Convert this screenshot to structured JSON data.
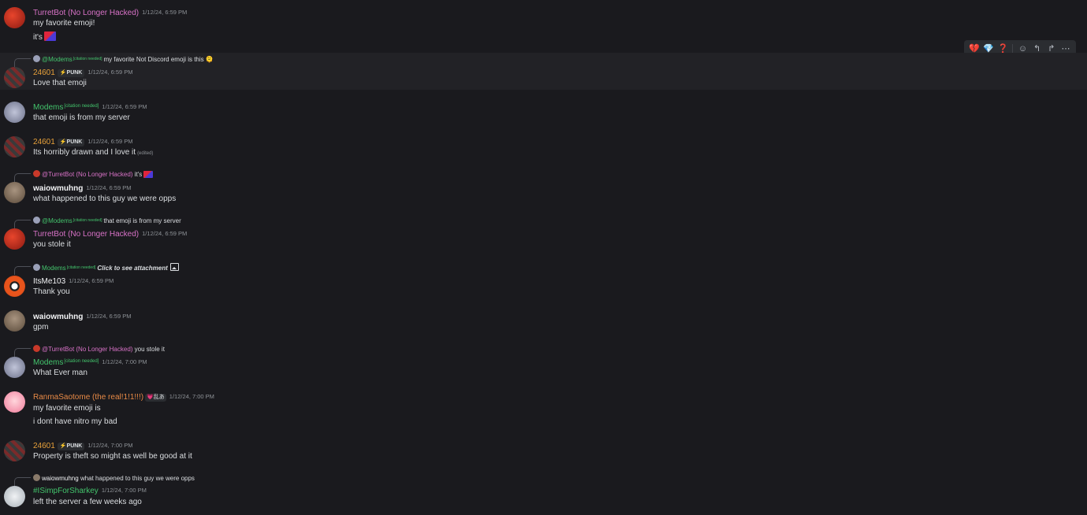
{
  "toolbar": {
    "buttons": [
      {
        "name": "react-broken-heart",
        "glyph": "💔",
        "color": "#e5484d"
      },
      {
        "name": "react-gem",
        "glyph": "💎",
        "color": "#6ec6f0"
      },
      {
        "name": "react-question",
        "glyph": "❓",
        "color": "#e5484d"
      },
      {
        "name": "add-reaction",
        "glyph": "☺",
        "color": "#b5bac1"
      },
      {
        "name": "reply",
        "glyph": "↰",
        "color": "#b5bac1"
      },
      {
        "name": "forward",
        "glyph": "↱",
        "color": "#b5bac1"
      },
      {
        "name": "more",
        "glyph": "⋯",
        "color": "#b5bac1"
      }
    ]
  },
  "messages": [
    {
      "author": "TurretBot (No Longer Hacked)",
      "time": "1/12/24, 6:59 PM",
      "lines": [
        "my favorite emoji!",
        "it's"
      ]
    },
    {
      "reply": {
        "name": "@Modems",
        "tag": "[citation needed]",
        "text": "my favorite Not Discord emoji is this 🫠"
      },
      "author": "24601",
      "badge": "PUNK",
      "time": "1/12/24, 6:59 PM",
      "lines": [
        "Love that emoji"
      ]
    },
    {
      "author": "Modems",
      "tag": "[citation needed]",
      "time": "1/12/24, 6:59 PM",
      "lines": [
        "that emoji is from my server"
      ]
    },
    {
      "author": "24601",
      "badge": "PUNK",
      "time": "1/12/24, 6:59 PM",
      "lines": [
        "Its horribly drawn and I love it"
      ],
      "edited": "(edited)"
    },
    {
      "reply": {
        "name": "@TurretBot (No Longer Hacked)",
        "text": "it's"
      },
      "author": "waiowmuhng",
      "time": "1/12/24, 6:59 PM",
      "lines": [
        "what happened to this guy we were opps"
      ]
    },
    {
      "reply": {
        "name": "@Modems",
        "tag": "[citation needed]",
        "text": "that emoji is from my server"
      },
      "author": "TurretBot (No Longer Hacked)",
      "time": "1/12/24, 6:59 PM",
      "lines": [
        "you stole it"
      ]
    },
    {
      "reply": {
        "name": "Modems",
        "tag": "[citation needed]",
        "text": "Click to see attachment"
      },
      "author": "ItsMe103",
      "time": "1/12/24, 6:59 PM",
      "lines": [
        "Thank you"
      ]
    },
    {
      "author": "waiowmuhng",
      "time": "1/12/24, 6:59 PM",
      "lines": [
        "gpm"
      ]
    },
    {
      "reply": {
        "name": "@TurretBot (No Longer Hacked)",
        "text": "you stole it"
      },
      "author": "Modems",
      "tag": "[citation needed]",
      "time": "1/12/24, 7:00 PM",
      "lines": [
        "What Ever man"
      ]
    },
    {
      "author": "RanmaSaotome (the real!1!1!!!)",
      "pill": "💗乱あ",
      "time": "1/12/24, 7:00 PM",
      "lines": [
        "my favorite emoji is",
        "i dont have nitro my bad"
      ]
    },
    {
      "author": "24601",
      "badge": "PUNK",
      "time": "1/12/24, 7:00 PM",
      "lines": [
        "Property is theft so might as well be good at it"
      ]
    },
    {
      "reply": {
        "name": "waiowmuhng",
        "text": "what happened to this guy we were opps"
      },
      "author": "#ISimpForSharkey",
      "time": "1/12/24, 7:00 PM",
      "lines": [
        "left the server a few weeks ago"
      ]
    }
  ],
  "colors": {
    "background": "#1a1a1e",
    "highlight": "#222226",
    "pink": "#d872c7",
    "orange": "#e8a13a",
    "green": "#43c46c",
    "salmon": "#e88a46",
    "text": "#dbdee1",
    "muted": "#8e9297"
  }
}
